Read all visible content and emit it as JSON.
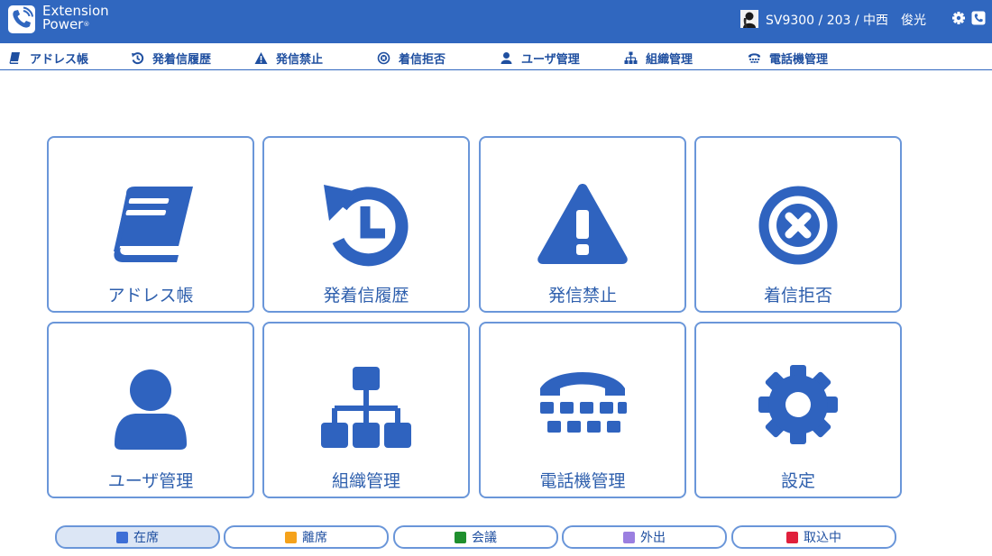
{
  "header": {
    "brand_line1": "Extension",
    "brand_line2": "Power",
    "brand_reg": "®",
    "user": "SV9300 / 203 / 中西　俊光",
    "bg_color": "#3067bf"
  },
  "nav": {
    "items": [
      {
        "label": "アドレス帳",
        "icon": "book-icon"
      },
      {
        "label": "発着信履歴",
        "icon": "history-icon"
      },
      {
        "label": "発信禁止",
        "icon": "warning-icon"
      },
      {
        "label": "着信拒否",
        "icon": "reject-icon"
      },
      {
        "label": "ユーザ管理",
        "icon": "user-icon"
      },
      {
        "label": "組織管理",
        "icon": "org-icon"
      },
      {
        "label": "電話機管理",
        "icon": "telephone-icon"
      }
    ]
  },
  "tiles": [
    {
      "label": "アドレス帳",
      "icon": "book-icon"
    },
    {
      "label": "発着信履歴",
      "icon": "history-icon"
    },
    {
      "label": "発信禁止",
      "icon": "warning-icon"
    },
    {
      "label": "着信拒否",
      "icon": "reject-icon"
    },
    {
      "label": "ユーザ管理",
      "icon": "user-icon"
    },
    {
      "label": "組織管理",
      "icon": "org-icon"
    },
    {
      "label": "電話機管理",
      "icon": "telephone-icon"
    },
    {
      "label": "設定",
      "icon": "gear-icon"
    }
  ],
  "status": [
    {
      "label": "在席",
      "color": "#3e6fd6",
      "active": true
    },
    {
      "label": "離席",
      "color": "#f5a21b",
      "active": false
    },
    {
      "label": "会議",
      "color": "#1f8f2e",
      "active": false
    },
    {
      "label": "外出",
      "color": "#9b7fe0",
      "active": false
    },
    {
      "label": "取込中",
      "color": "#e0203c",
      "active": false
    }
  ],
  "colors": {
    "accent": "#3067bf",
    "icon": "#2f63bf",
    "tile_border": "#6a96d9"
  }
}
